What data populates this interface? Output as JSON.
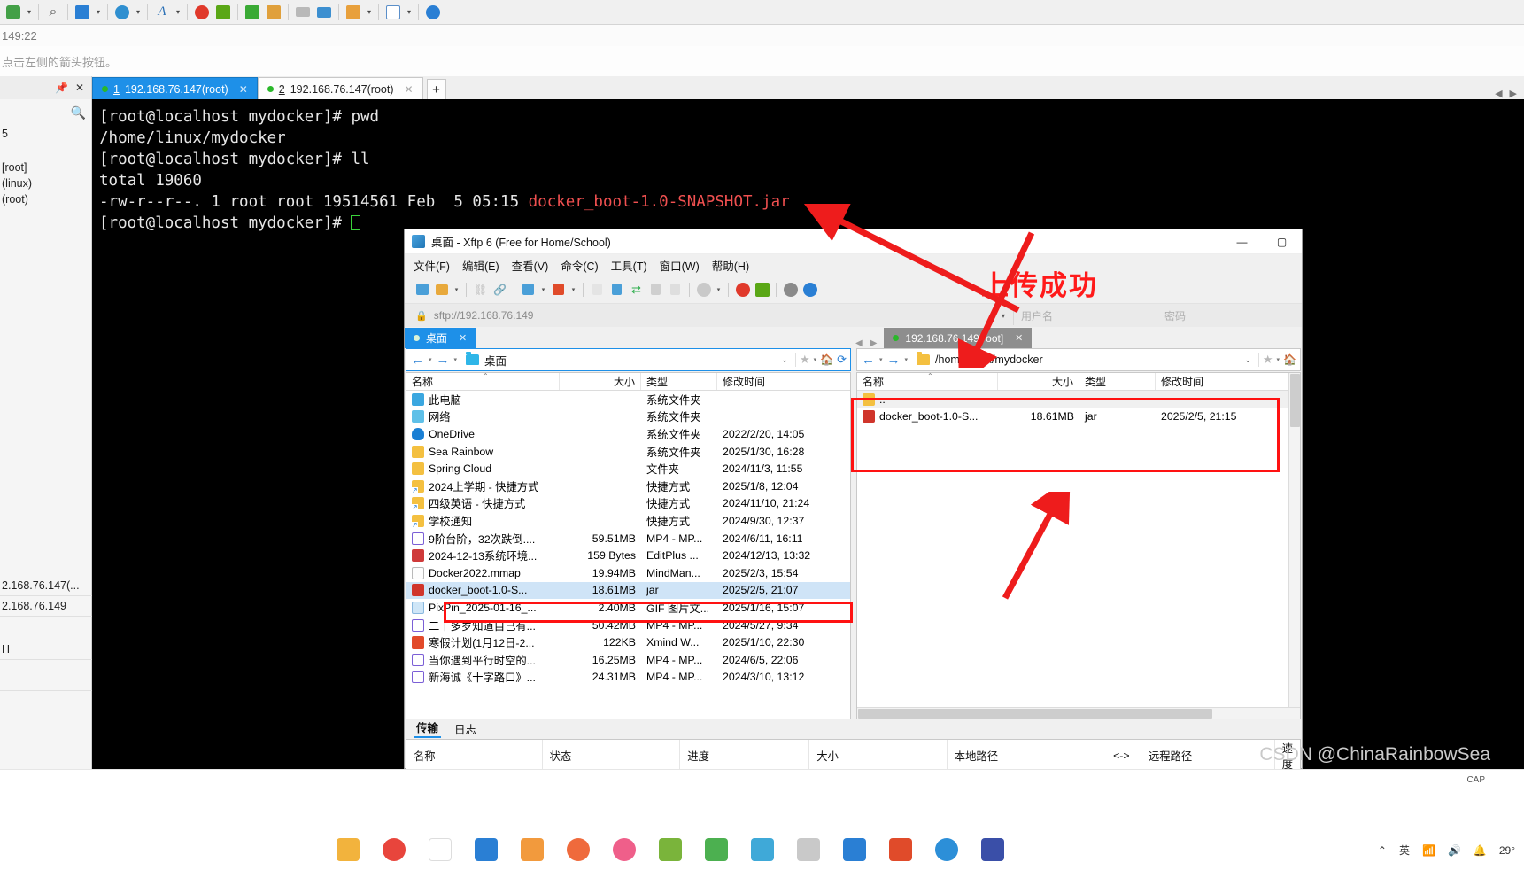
{
  "xshell": {
    "toolbar_icons": [
      "settings-gear-icon",
      "caret-down-icon",
      "search-icon",
      "split-layout-icon",
      "caret-down-icon",
      "globe-icon",
      "caret-down-icon",
      "font-icon",
      "caret-down-icon",
      "spiral-icon",
      "green-app-icon",
      "fullscreen-icon",
      "lock-icon",
      "keyboard-icon",
      "pen-icon",
      "new-window-icon",
      "caret-down-icon",
      "layout-icon",
      "caret-down-icon",
      "help-icon"
    ],
    "info_text": "149:22",
    "hint_text": "点击左侧的箭头按钮。",
    "sidebar": {
      "pin": "📌",
      "close": "✕",
      "search": "🔍",
      "items": [
        "5",
        "[root]",
        "(linux)",
        "(root)"
      ],
      "lower_items": [
        "2.168.76.147(...",
        "2.168.76.149",
        "H"
      ]
    },
    "tabs": [
      {
        "num": "1",
        "label": "192.168.76.147(root)",
        "active": true
      },
      {
        "num": "2",
        "label": "192.168.76.147(root)",
        "active": false
      }
    ],
    "new_tab_label": "+",
    "terminal": {
      "line1": "[root@localhost mydocker]# pwd",
      "line2": "/home/linux/mydocker",
      "line3": "[root@localhost mydocker]# ll",
      "line4": "total 19060",
      "line5_pre": "-rw-r--r--. 1 root root 19514561 Feb  5 05:15 ",
      "line5_file": "docker_boot-1.0-SNAPSHOT.jar",
      "line6": "[root@localhost mydocker]# "
    }
  },
  "xftp": {
    "title": "桌面 - Xftp 6 (Free for Home/School)",
    "window_buttons": {
      "minimize": "—",
      "maximize": "▢"
    },
    "menu": [
      "文件(F)",
      "编辑(E)",
      "查看(V)",
      "命令(C)",
      "工具(T)",
      "窗口(W)",
      "帮助(H)"
    ],
    "toolbar_icons": [
      "new-folder-icon",
      "open-folder-icon",
      "caret-down-icon",
      "disconnect-icon",
      "link-icon",
      "new-session-icon",
      "caret-down-icon",
      "run-icon",
      "caret-down-icon",
      "file-icon",
      "file-transfer-icon",
      "sync-icon",
      "copy-icon",
      "paste-icon",
      "circle-icon",
      "caret-down-icon",
      "spiral-icon",
      "green-app-icon",
      "gear-icon",
      "help-icon"
    ],
    "address": {
      "url": "sftp://192.168.76.149",
      "username_placeholder": "用户名",
      "password_placeholder": "密码"
    },
    "local": {
      "tab_label": "桌面",
      "path": "桌面",
      "columns": [
        "名称",
        "大小",
        "类型",
        "修改时间"
      ],
      "rows": [
        {
          "icon": "pc-icon",
          "name": "此电脑",
          "size": "",
          "type": "系统文件夹",
          "date": ""
        },
        {
          "icon": "network-icon",
          "name": "网络",
          "size": "",
          "type": "系统文件夹",
          "date": ""
        },
        {
          "icon": "cloud-icon",
          "name": "OneDrive",
          "size": "",
          "type": "系统文件夹",
          "date": "2022/2/20, 14:05"
        },
        {
          "icon": "folder-icon",
          "name": "Sea Rainbow",
          "size": "",
          "type": "系统文件夹",
          "date": "2025/1/30, 16:28"
        },
        {
          "icon": "folder-icon",
          "name": "Spring Cloud",
          "size": "",
          "type": "文件夹",
          "date": "2024/11/3, 11:55"
        },
        {
          "icon": "shortcut-icon",
          "name": "2024上学期 - 快捷方式",
          "size": "",
          "type": "快捷方式",
          "date": "2025/1/8, 12:04"
        },
        {
          "icon": "shortcut-icon",
          "name": "四级英语 - 快捷方式",
          "size": "",
          "type": "快捷方式",
          "date": "2024/11/10, 21:24"
        },
        {
          "icon": "shortcut-icon",
          "name": "学校通知",
          "size": "",
          "type": "快捷方式",
          "date": "2024/9/30, 12:37"
        },
        {
          "icon": "mp4-icon",
          "name": "9阶台阶，32次跌倒....",
          "size": "59.51MB",
          "type": "MP4 - MP...",
          "date": "2024/6/11, 16:11"
        },
        {
          "icon": "editplus-icon",
          "name": "2024-12-13系统环境...",
          "size": "159 Bytes",
          "type": "EditPlus ...",
          "date": "2024/12/13, 13:32"
        },
        {
          "icon": "doc-icon",
          "name": "Docker2022.mmap",
          "size": "19.94MB",
          "type": "MindMan...",
          "date": "2025/2/3, 15:54"
        },
        {
          "icon": "jar-icon",
          "name": "docker_boot-1.0-S...",
          "size": "18.61MB",
          "type": "jar",
          "date": "2025/2/5, 21:07",
          "selected": true
        },
        {
          "icon": "gif-icon",
          "name": "PixPin_2025-01-16_...",
          "size": "2.40MB",
          "type": "GIF 图片文...",
          "date": "2025/1/16, 15:07"
        },
        {
          "icon": "mp4-icon",
          "name": "二十多岁知道自己有...",
          "size": "50.42MB",
          "type": "MP4 - MP...",
          "date": "2024/5/27, 9:34"
        },
        {
          "icon": "xmind-icon",
          "name": "寒假计划(1月12日-2...",
          "size": "122KB",
          "type": "Xmind W...",
          "date": "2025/1/10, 22:30"
        },
        {
          "icon": "mp4-icon",
          "name": "当你遇到平行时空的...",
          "size": "16.25MB",
          "type": "MP4 - MP...",
          "date": "2024/6/5, 22:06"
        },
        {
          "icon": "mp4-icon",
          "name": "新海诚《十字路口》...",
          "size": "24.31MB",
          "type": "MP4 - MP...",
          "date": "2024/3/10, 13:12"
        }
      ]
    },
    "remote": {
      "tab_label": "192.168.76.149[root]",
      "path": "/home/linux/mydocker",
      "columns": [
        "名称",
        "大小",
        "类型",
        "修改时间"
      ],
      "rows": [
        {
          "icon": "folder-icon",
          "name": "..",
          "size": "",
          "type": "",
          "date": ""
        },
        {
          "icon": "jar-icon",
          "name": "docker_boot-1.0-S...",
          "size": "18.61MB",
          "type": "jar",
          "date": "2025/2/5, 21:15"
        }
      ]
    },
    "transfer": {
      "tabs": [
        "传输",
        "日志"
      ],
      "active_tab": "传输",
      "columns": [
        "名称",
        "状态",
        "进度",
        "大小",
        "本地路径",
        "<->",
        "远程路径",
        "速度"
      ]
    }
  },
  "annotations": {
    "success_text": "上传成功",
    "accent_red": "#ff1212",
    "arrow_color": "#ee1c1c"
  },
  "taskbar": {
    "watermark": "CSDN @ChinaRainbowSea",
    "cap_badge": "CAP",
    "tray_items": [
      "英",
      "wifi-icon",
      "speaker-icon",
      "notification-icon"
    ],
    "tray_label": "29°"
  }
}
